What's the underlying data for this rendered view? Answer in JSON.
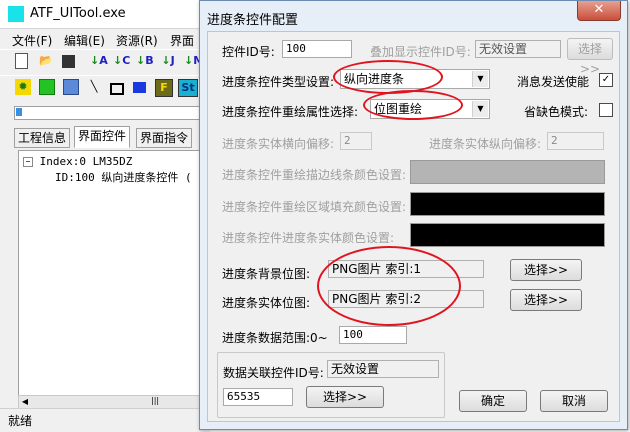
{
  "main_window": {
    "title": "ATF_UITool.exe",
    "menu": [
      "文件(F)",
      "编辑(E)",
      "资源(R)",
      "界面"
    ],
    "toolbar1": [
      "new-file-icon",
      "open-folder-icon",
      "save-icon",
      "arrow-a-icon",
      "arrow-c-icon",
      "arrow-b-icon",
      "arrow-j-icon",
      "arrow-m-icon"
    ],
    "toolbar2": [
      "sun-icon",
      "green-square-icon",
      "picture-icon",
      "line-icon",
      "rectangle-icon",
      "filled-rect-icon",
      "f-icon",
      "st-icon",
      "more-icon"
    ],
    "toolbar2_labels": {
      "a": "A",
      "c": "C",
      "b": "B",
      "j": "J",
      "m": "M",
      "f": "F",
      "st": "St"
    },
    "progress": 0.03,
    "tabs": [
      "工程信息",
      "界面控件",
      "界面指令"
    ],
    "active_tab": 1,
    "tree": {
      "root": "Index:0 LM35DZ",
      "child": "ID:100 纵向进度条控件 ("
    },
    "status": "就绪"
  },
  "dialog": {
    "title": "进度条控件配置",
    "close_label": "✕",
    "control_id_label": "控件ID号:",
    "control_id_value": "100",
    "overlay_id_label": "叠加显示控件ID号:",
    "overlay_id_value": "无效设置",
    "overlay_select_label": "选择>>",
    "type_label": "进度条控件类型设置:",
    "type_value": "纵向进度条",
    "msg_send_label": "消息发送使能",
    "msg_send_checked": "✓",
    "redraw_label": "进度条控件重绘属性选择:",
    "redraw_value": "位图重绘",
    "default_color_label": "省缺色模式:",
    "h_offset_label": "进度条实体横向偏移:",
    "h_offset_value": "2",
    "v_offset_label": "进度条实体纵向偏移:",
    "v_offset_value": "2",
    "border_color_label": "进度条控件重绘描边线条颜色设置:",
    "fill_color_label": "进度条控件重绘区域填充颜色设置:",
    "entity_color_label": "进度条控件进度条实体颜色设置:",
    "colors": {
      "border": "#b4b4b4",
      "fill": "#000000",
      "entity": "#000000",
      "highlight": "#e0141e"
    },
    "bg_bitmap_label": "进度条背景位图:",
    "bg_bitmap_value": "PNG图片  索引:1",
    "bg_select_label": "选择>>",
    "entity_bitmap_label": "进度条实体位图:",
    "entity_bitmap_value": "PNG图片  索引:2",
    "entity_select_label": "选择>>",
    "range_label": "进度条数据范围:0~",
    "range_value": "100",
    "link_id_label": "数据关联控件ID号:",
    "link_id_value": "无效设置",
    "link_id_number": "65535",
    "link_select_label": "选择>>",
    "ok_label": "确定",
    "cancel_label": "取消"
  }
}
